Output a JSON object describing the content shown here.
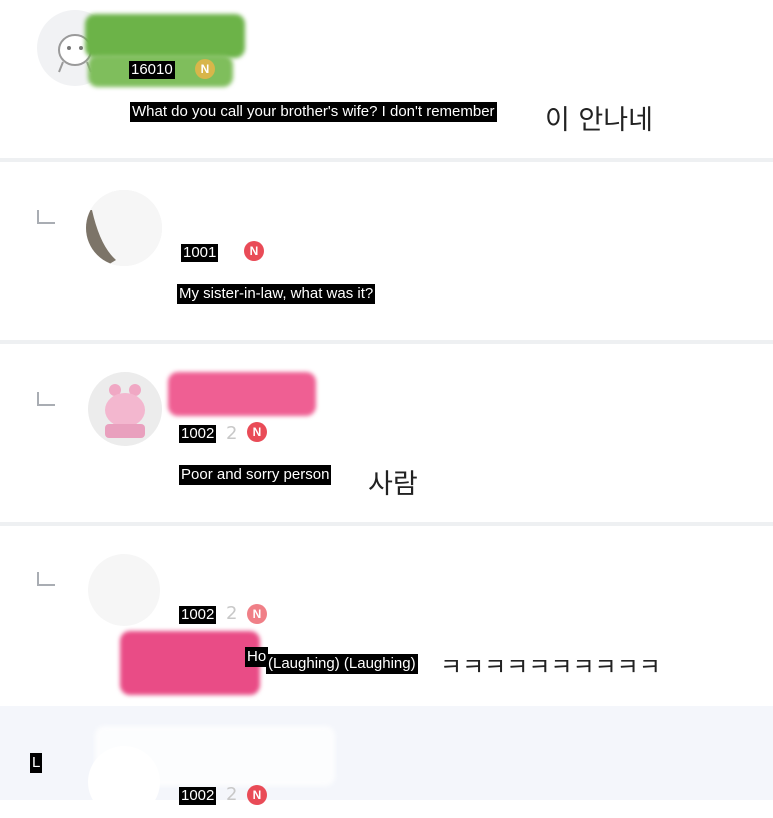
{
  "colors": {
    "divider": "#eef0f2",
    "highlight_row": "#f4f6fb",
    "badge_red": "#e94b57",
    "badge_gold": "#d8b64a",
    "blur_green": "#6cb348",
    "blur_pink": "#ef5f93"
  },
  "comments": [
    {
      "nickname": "16010",
      "badge": "N",
      "caption": "What do you call your brother's wife? I don't remember",
      "original_tail": "이 안나네",
      "icons": [
        "avatar-character-icon",
        "n-badge-icon"
      ]
    },
    {
      "nickname": "1001",
      "badge": "N",
      "caption": "My sister-in-law, what was it?",
      "icons": [
        "reply-arrow-icon",
        "avatar-icon",
        "n-badge-icon"
      ]
    },
    {
      "nickname": "1002",
      "faded_digit": "2",
      "badge": "N",
      "caption": "Poor and sorry person",
      "original_tail": "사람",
      "icons": [
        "reply-arrow-icon",
        "avatar-hippo-icon",
        "n-badge-icon"
      ]
    },
    {
      "nickname": "1002",
      "faded_digit": "2",
      "badge": "N",
      "prefix": "Ho",
      "caption": "(Laughing) (Laughing)",
      "original_tail": "ㅋㅋㅋㅋㅋㅋㅋㅋㅋㅋ",
      "icons": [
        "reply-arrow-icon",
        "avatar-icon",
        "n-badge-icon"
      ]
    },
    {
      "reply_mark_label": "L",
      "nickname": "1002",
      "faded_digit": "2",
      "badge": "N",
      "icons": [
        "avatar-icon",
        "n-badge-icon"
      ]
    }
  ]
}
